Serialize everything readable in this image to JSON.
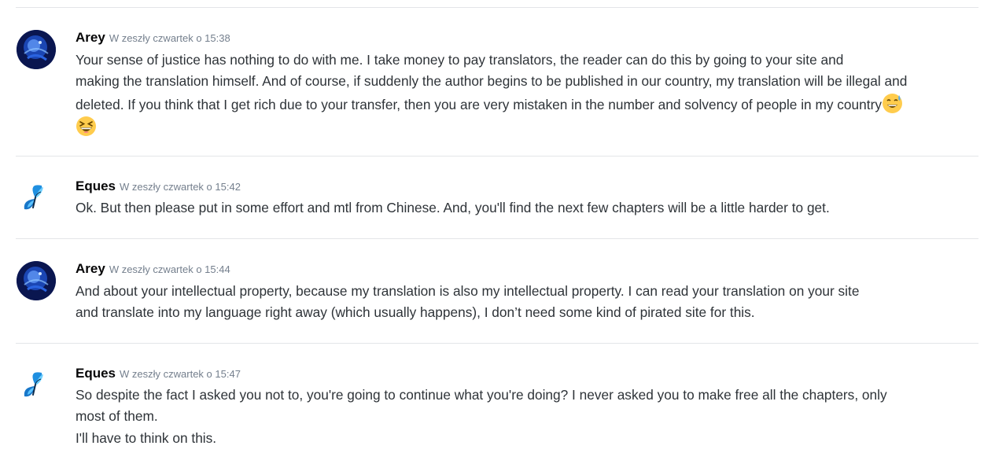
{
  "messages": [
    {
      "author": "Arey",
      "timestamp": "W zeszły czwartek o 15:38",
      "avatar": "arey-avatar-icon",
      "lines": [
        "Your sense of justice has nothing to do with me.  I take money to pay translators, the reader can do this by going to your site and",
        "making the translation himself.  And of course, if suddenly the author begins to be published in our country, my translation will be illegal and",
        "deleted.  If you think that I get rich due to your transfer, then you are very mistaken in the number and solvency of people in my country"
      ],
      "emojis": [
        "sweat-smile-emoji",
        "laughing-emoji"
      ]
    },
    {
      "author": "Eques",
      "timestamp": "W zeszły czwartek o 15:42",
      "avatar": "butterfly-icon",
      "lines": [
        "Ok. But then please put in some effort and mtl from Chinese. And, you'll find the next few chapters will be a little harder to get."
      ]
    },
    {
      "author": "Arey",
      "timestamp": "W zeszły czwartek o 15:44",
      "avatar": "arey-avatar-icon",
      "lines": [
        "And about your intellectual property, because my translation is also my intellectual property.  I can read your translation on your site",
        "and translate into my language right away (which usually happens), I don’t need some kind of pirated site for this."
      ]
    },
    {
      "author": "Eques",
      "timestamp": "W zeszły czwartek o 15:47",
      "avatar": "butterfly-icon",
      "lines": [
        "So despite the fact I asked you not to, you're going to continue what you're doing? I never asked you to make free all the chapters, only",
        "most of them.",
        "I'll have to think on this."
      ]
    }
  ]
}
